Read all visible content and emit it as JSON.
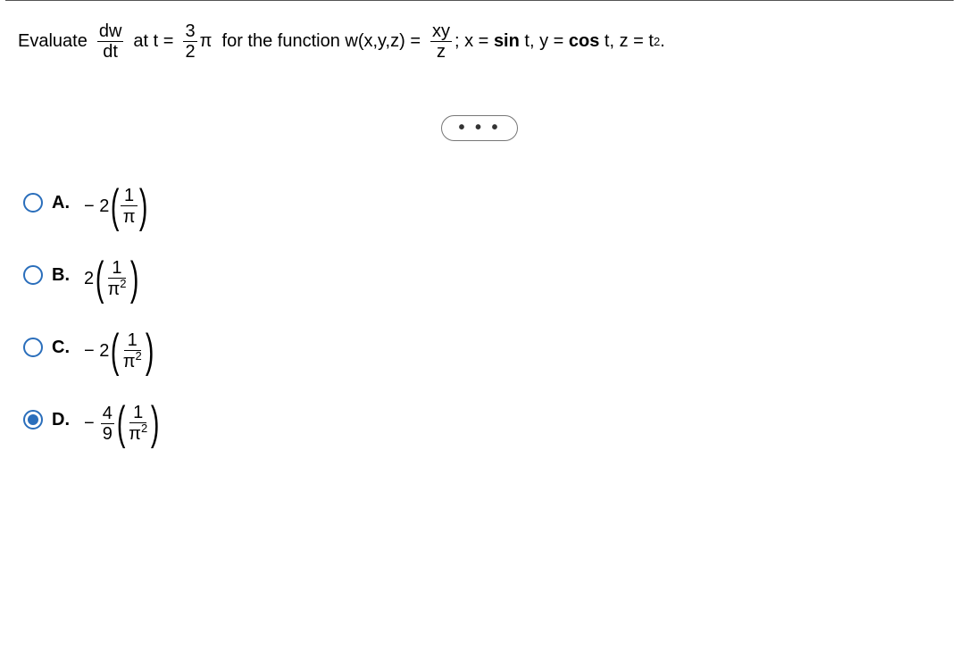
{
  "question": {
    "lead": "Evaluate",
    "dwdt_num": "dw",
    "dwdt_den": "dt",
    "at_t_eq": "at t =",
    "threeover2_num": "3",
    "threeover2_den": "2",
    "pi_text": "π",
    "forfn": "for the function w(x,y,z) =",
    "xy": "xy",
    "z": "z",
    "semicolon_defs": "; x =",
    "sint": "sin",
    "t_comma": "t,  y =",
    "cost": "cos",
    "tzeq": "t, z = t",
    "sq": "2",
    "period": "."
  },
  "ellipsis": "• • •",
  "options": [
    {
      "letter": "A.",
      "selected": false,
      "coef_prefix": "− 2",
      "has_outer_frac": false,
      "inner_num": "1",
      "inner_den_pi": "π",
      "inner_den_exp": ""
    },
    {
      "letter": "B.",
      "selected": false,
      "coef_prefix": "2",
      "has_outer_frac": false,
      "inner_num": "1",
      "inner_den_pi": "π",
      "inner_den_exp": "2"
    },
    {
      "letter": "C.",
      "selected": false,
      "coef_prefix": "− 2",
      "has_outer_frac": false,
      "inner_num": "1",
      "inner_den_pi": "π",
      "inner_den_exp": "2"
    },
    {
      "letter": "D.",
      "selected": true,
      "coef_prefix": "−",
      "has_outer_frac": true,
      "outer_num": "4",
      "outer_den": "9",
      "inner_num": "1",
      "inner_den_pi": "π",
      "inner_den_exp": "2"
    }
  ]
}
